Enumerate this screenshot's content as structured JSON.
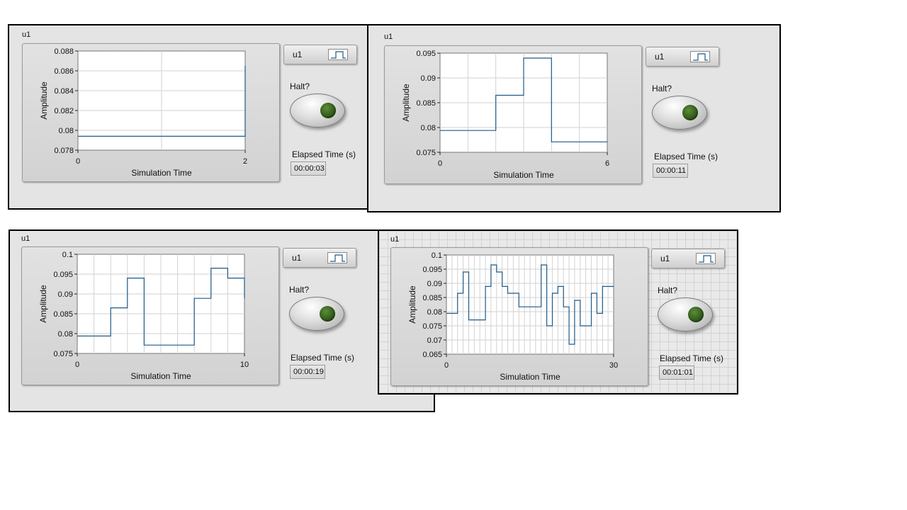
{
  "colors": {
    "trace": "#1f5a87",
    "plot_bg": "#ffffff",
    "grid": "#d2d2d2"
  },
  "panels": [
    {
      "label": "u1",
      "legend_label": "u1",
      "halt_label": "Halt?",
      "elapsed_label": "Elapsed Time (s)",
      "elapsed_value": "00:00:03",
      "chart_data": {
        "type": "line",
        "xlabel": "Simulation Time",
        "ylabel": "Amplitude",
        "xlim": [
          0,
          2
        ],
        "ylim": [
          0.078,
          0.088
        ],
        "xticks": [
          0,
          2
        ],
        "xtick_labels": [
          "0",
          "2"
        ],
        "yticks": [
          0.078,
          0.08,
          0.082,
          0.084,
          0.086,
          0.088
        ],
        "ytick_labels": [
          "0.078",
          "0.08",
          "0.082",
          "0.084",
          "0.086",
          "0.088"
        ],
        "xgrid": [
          1
        ],
        "ygrid": [
          0.08,
          0.082,
          0.084,
          0.086
        ],
        "series": [
          {
            "name": "u1",
            "x": [
              0,
              2,
              2
            ],
            "y": [
              0.0794,
              0.0794,
              0.0865
            ]
          }
        ]
      }
    },
    {
      "label": "u1",
      "legend_label": "u1",
      "halt_label": "Halt?",
      "elapsed_label": "Elapsed Time (s)",
      "elapsed_value": "00:00:11",
      "chart_data": {
        "type": "line",
        "xlabel": "Simulation Time",
        "ylabel": "Amplitude",
        "xlim": [
          0,
          6
        ],
        "ylim": [
          0.075,
          0.095
        ],
        "xticks": [
          0,
          6
        ],
        "xtick_labels": [
          "0",
          "6"
        ],
        "yticks": [
          0.075,
          0.08,
          0.085,
          0.09,
          0.095
        ],
        "ytick_labels": [
          "0.075",
          "0.08",
          "0.085",
          "0.09",
          "0.095"
        ],
        "xgrid": [
          1,
          2,
          3,
          4,
          5
        ],
        "ygrid": [
          0.08,
          0.085,
          0.09
        ],
        "series": [
          {
            "name": "u1",
            "x": [
              0,
              2,
              2,
              3,
              3,
              4,
              4,
              6
            ],
            "y": [
              0.0794,
              0.0794,
              0.0865,
              0.0865,
              0.094,
              0.094,
              0.0771,
              0.0771
            ]
          }
        ]
      }
    },
    {
      "label": "u1",
      "legend_label": "u1",
      "halt_label": "Halt?",
      "elapsed_label": "Elapsed Time (s)",
      "elapsed_value": "00:00:19",
      "chart_data": {
        "type": "line",
        "xlabel": "Simulation Time",
        "ylabel": "Amplitude",
        "xlim": [
          0,
          10
        ],
        "ylim": [
          0.075,
          0.1
        ],
        "xticks": [
          0,
          10
        ],
        "xtick_labels": [
          "0",
          "10"
        ],
        "yticks": [
          0.075,
          0.08,
          0.085,
          0.09,
          0.095,
          0.1
        ],
        "ytick_labels": [
          "0.075",
          "0.08",
          "0.085",
          "0.09",
          "0.095",
          "0.1"
        ],
        "xgrid": [
          1,
          2,
          3,
          4,
          5,
          6,
          7,
          8,
          9
        ],
        "ygrid": [
          0.08,
          0.085,
          0.09,
          0.095
        ],
        "series": [
          {
            "name": "u1",
            "x": [
              0,
              2,
              2,
              3,
              3,
              4,
              4,
              7,
              7,
              8,
              8,
              9,
              9,
              10,
              10
            ],
            "y": [
              0.0794,
              0.0794,
              0.0865,
              0.0865,
              0.094,
              0.094,
              0.0771,
              0.0771,
              0.0889,
              0.0889,
              0.0965,
              0.0965,
              0.094,
              0.094,
              0.0889
            ]
          }
        ]
      }
    },
    {
      "label": "u1",
      "legend_label": "u1",
      "halt_label": "Halt?",
      "elapsed_label": "Elapsed Time (s)",
      "elapsed_value": "00:01:01",
      "chart_data": {
        "type": "line",
        "xlabel": "Simulation Time",
        "ylabel": "Amplitude",
        "xlim": [
          0,
          30
        ],
        "ylim": [
          0.065,
          0.1
        ],
        "xticks": [
          0,
          30
        ],
        "xtick_labels": [
          "0",
          "30"
        ],
        "yticks": [
          0.065,
          0.07,
          0.075,
          0.08,
          0.085,
          0.09,
          0.095,
          0.1
        ],
        "ytick_labels": [
          "0.065",
          "0.07",
          "0.075",
          "0.08",
          "0.085",
          "0.09",
          "0.095",
          "0.1"
        ],
        "xgrid": [
          1,
          2,
          3,
          4,
          5,
          6,
          7,
          8,
          9,
          10,
          11,
          12,
          13,
          14,
          15,
          16,
          17,
          18,
          19,
          20,
          21,
          22,
          23,
          24,
          25,
          26,
          27,
          28,
          29
        ],
        "ygrid": [
          0.07,
          0.075,
          0.08,
          0.085,
          0.09,
          0.095
        ],
        "series": [
          {
            "name": "u1",
            "x": [
              0,
              2,
              2,
              3,
              3,
              4,
              4,
              7,
              7,
              8,
              8,
              9,
              9,
              10,
              10,
              11,
              11,
              13,
              13,
              17,
              17,
              18,
              18,
              19,
              19,
              20,
              20,
              21,
              21,
              22,
              22,
              23,
              23,
              24,
              24,
              26,
              26,
              27,
              27,
              28,
              28,
              29,
              29,
              30
            ],
            "y": [
              0.0794,
              0.0794,
              0.0865,
              0.0865,
              0.094,
              0.094,
              0.0771,
              0.0771,
              0.0889,
              0.0889,
              0.0965,
              0.0965,
              0.094,
              0.094,
              0.0889,
              0.0889,
              0.0865,
              0.0865,
              0.0817,
              0.0817,
              0.0965,
              0.0965,
              0.075,
              0.075,
              0.0865,
              0.0865,
              0.0889,
              0.0889,
              0.0817,
              0.0817,
              0.0685,
              0.0685,
              0.084,
              0.084,
              0.075,
              0.075,
              0.0865,
              0.0865,
              0.0794,
              0.0794,
              0.0889,
              0.0889,
              0.0889,
              0.0889
            ]
          }
        ]
      }
    }
  ]
}
